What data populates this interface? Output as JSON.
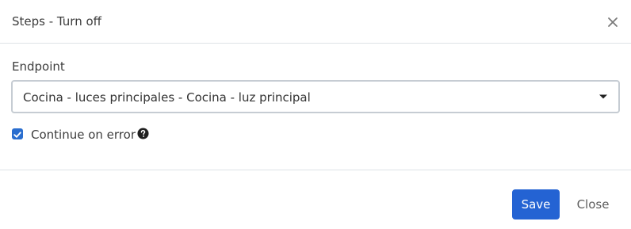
{
  "dialog": {
    "title": "Steps - Turn off",
    "close_icon": "close-icon"
  },
  "form": {
    "endpoint_label": "Endpoint",
    "endpoint_value": "Cocina - luces principales - Cocina - luz principal",
    "continue_on_error_label": "Continue on error",
    "continue_on_error_checked": true,
    "help_icon": "question-circle-icon"
  },
  "footer": {
    "save_label": "Save",
    "close_label": "Close"
  },
  "colors": {
    "primary": "#2463d3",
    "checkbox": "#2a6ecf",
    "border": "#dee2e6",
    "select_border": "#c6ccd3"
  }
}
